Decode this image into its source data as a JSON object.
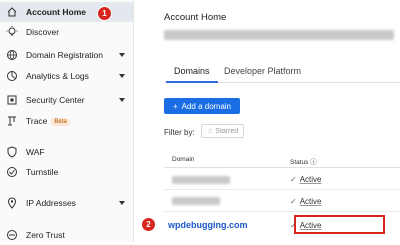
{
  "sidebar": {
    "items": [
      {
        "label": "Account Home",
        "icon": "home-icon"
      },
      {
        "label": "Discover",
        "icon": "lightbulb-icon"
      },
      {
        "label": "Domain Registration",
        "icon": "globe-icon"
      },
      {
        "label": "Analytics & Logs",
        "icon": "analytics-icon"
      },
      {
        "label": "Security Center",
        "icon": "shield-icon"
      },
      {
        "label": "Trace",
        "icon": "trace-icon",
        "badge": "Beta"
      },
      {
        "label": "WAF",
        "icon": "waf-shield-icon"
      },
      {
        "label": "Turnstile",
        "icon": "turnstile-icon"
      },
      {
        "label": "IP Addresses",
        "icon": "location-pin-icon"
      },
      {
        "label": "Zero Trust",
        "icon": "zero-trust-icon"
      }
    ]
  },
  "markers": {
    "step1": "1",
    "step2": "2"
  },
  "main": {
    "title": "Account Home",
    "tabs": [
      {
        "label": "Domains"
      },
      {
        "label": "Developer Platform"
      }
    ],
    "add_button": "Add a domain",
    "add_button_icon": "+",
    "filter_label": "Filter by:",
    "starred_label": "Starred",
    "table": {
      "headers": {
        "domain": "Domain",
        "status": "Status ⓘ"
      },
      "rows": [
        {
          "domain": "",
          "status": "Active"
        },
        {
          "domain": "",
          "status": "Active"
        },
        {
          "domain": "wpdebugging.com",
          "status": "Active"
        }
      ]
    }
  },
  "colors": {
    "accent": "#1a6de4",
    "marker": "#d7261e"
  }
}
